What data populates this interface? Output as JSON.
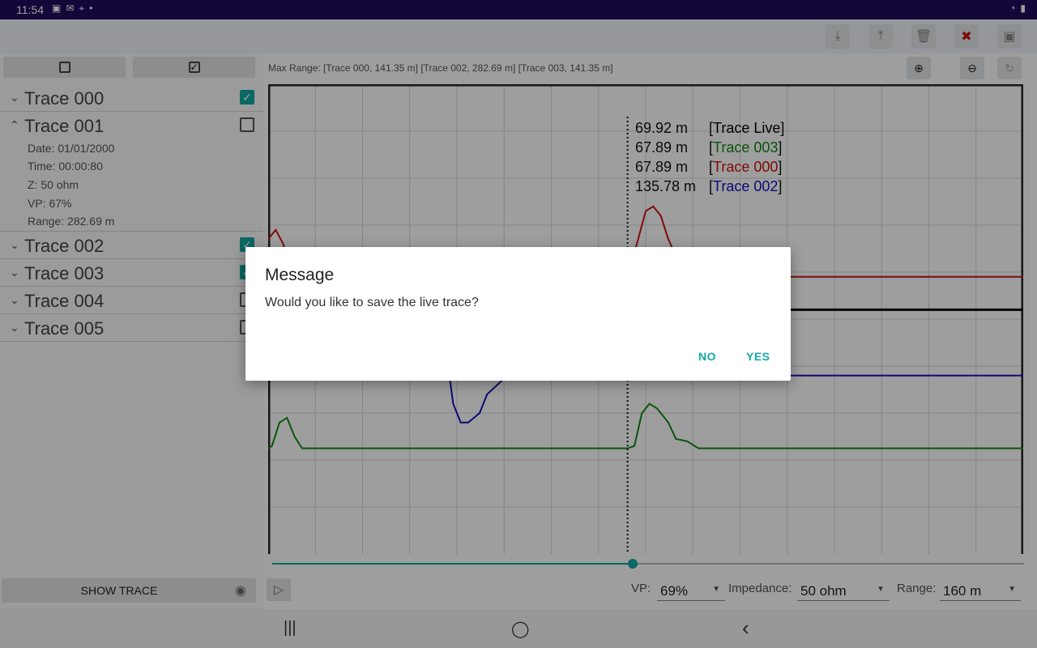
{
  "status_bar": {
    "time": "11:54",
    "left_icons": [
      "gallery-icon",
      "mail-icon",
      "location-icon",
      "dot-icon"
    ],
    "right_icons": [
      "wifi-icon",
      "battery-icon"
    ]
  },
  "toolbar": {
    "buttons": [
      "download-icon",
      "upload-icon",
      "trash-icon",
      "close-icon",
      "image-icon"
    ]
  },
  "left_panel": {
    "select_none_symbol": "☐",
    "select_all_symbol": "☑",
    "traces": [
      {
        "label": "Trace 000",
        "expanded": false,
        "checked": true
      },
      {
        "label": "Trace 001",
        "expanded": true,
        "checked": false
      },
      {
        "label": "Trace 002",
        "expanded": false,
        "checked": true
      },
      {
        "label": "Trace 003",
        "expanded": false,
        "checked": true
      },
      {
        "label": "Trace 004",
        "expanded": false,
        "checked": false
      },
      {
        "label": "Trace 005",
        "expanded": false,
        "checked": false
      }
    ],
    "details": {
      "date": "Date: 01/01/2000",
      "time": "Time: 00:00:80",
      "z": "Z: 50 ohm",
      "vp": "VP: 67%",
      "range": "Range: 282.69 m"
    },
    "show_trace_label": "SHOW TRACE"
  },
  "plot_header": {
    "max_range": "Max Range: [Trace 000, 141.35 m] [Trace 002, 282.69 m] [Trace 003, 141.35 m]"
  },
  "readouts": [
    {
      "value": "69.92 m",
      "name": "Trace Live",
      "color": "#000000"
    },
    {
      "value": "67.89 m",
      "name": "Trace 003",
      "color": "#118811"
    },
    {
      "value": "67.89 m",
      "name": "Trace 000",
      "color": "#cc1111"
    },
    {
      "value": "135.78 m",
      "name": "Trace 002",
      "color": "#1111bb"
    }
  ],
  "chart_data": {
    "type": "line",
    "grid": true,
    "cursor_position_fraction": 0.476,
    "series": [
      {
        "name": "Trace 000",
        "color": "#cc1111",
        "points": [
          [
            0,
            0.33
          ],
          [
            0.01,
            0.31
          ],
          [
            0.02,
            0.34
          ],
          [
            0.03,
            0.4
          ],
          [
            0.05,
            0.41
          ],
          [
            0.476,
            0.41
          ],
          [
            0.49,
            0.33
          ],
          [
            0.5,
            0.27
          ],
          [
            0.51,
            0.26
          ],
          [
            0.52,
            0.28
          ],
          [
            0.53,
            0.33
          ],
          [
            0.55,
            0.4
          ],
          [
            0.57,
            0.41
          ],
          [
            1,
            0.41
          ]
        ]
      },
      {
        "name": "Trace Live",
        "color": "#000000",
        "points": [
          [
            0,
            0.48
          ],
          [
            0.476,
            0.48
          ],
          [
            0.56,
            0.48
          ],
          [
            1,
            0.48
          ]
        ]
      },
      {
        "name": "Trace 002",
        "color": "#1111bb",
        "points": [
          [
            0,
            0.4
          ],
          [
            0.1,
            0.45
          ],
          [
            0.2,
            0.52
          ],
          [
            0.24,
            0.62
          ],
          [
            0.245,
            0.68
          ],
          [
            0.255,
            0.72
          ],
          [
            0.265,
            0.72
          ],
          [
            0.28,
            0.7
          ],
          [
            0.29,
            0.66
          ],
          [
            0.31,
            0.63
          ],
          [
            0.32,
            0.62
          ],
          [
            0.476,
            0.62
          ],
          [
            0.5,
            0.62
          ],
          [
            1,
            0.62
          ]
        ]
      },
      {
        "name": "Trace 003",
        "color": "#118811",
        "points": [
          [
            0,
            0.775
          ],
          [
            0.005,
            0.77
          ],
          [
            0.015,
            0.72
          ],
          [
            0.025,
            0.71
          ],
          [
            0.035,
            0.75
          ],
          [
            0.045,
            0.775
          ],
          [
            0.476,
            0.775
          ],
          [
            0.485,
            0.77
          ],
          [
            0.495,
            0.7
          ],
          [
            0.505,
            0.68
          ],
          [
            0.515,
            0.69
          ],
          [
            0.53,
            0.72
          ],
          [
            0.54,
            0.755
          ],
          [
            0.555,
            0.76
          ],
          [
            0.57,
            0.775
          ],
          [
            1,
            0.775
          ]
        ]
      }
    ]
  },
  "slider": {
    "value_fraction": 0.48
  },
  "settings": {
    "vp_label": "VP:",
    "vp_value": "69%",
    "impedance_label": "Impedance:",
    "impedance_value": "50 ohm",
    "range_label": "Range:",
    "range_value": "160 m"
  },
  "nav": {
    "recents": "|||",
    "home": "◯",
    "back": "‹"
  },
  "dialog": {
    "title": "Message",
    "message": "Would you like to save the live trace?",
    "no_label": "NO",
    "yes_label": "YES"
  }
}
